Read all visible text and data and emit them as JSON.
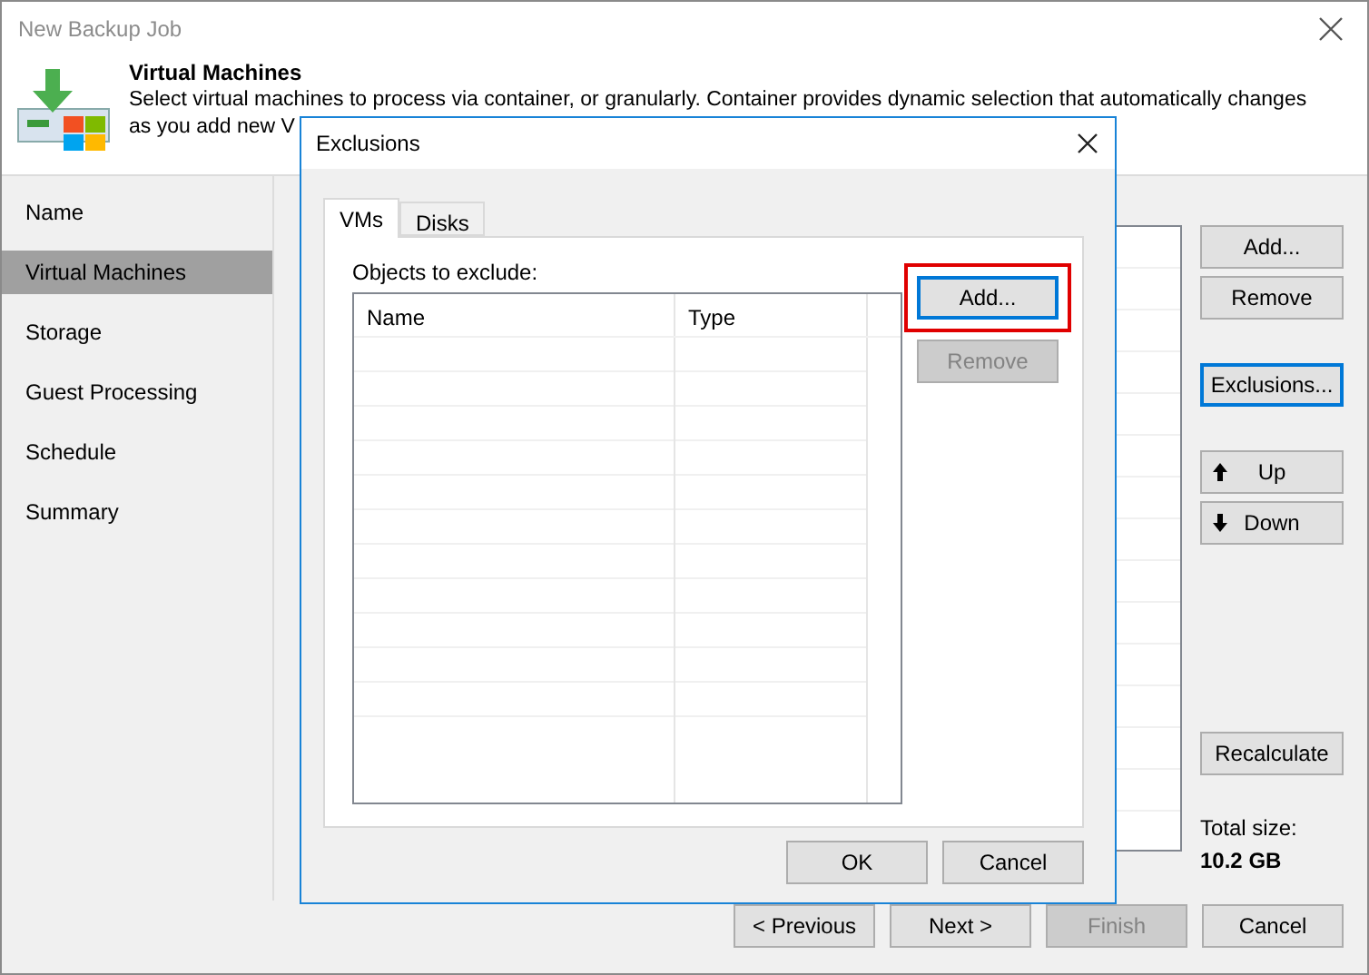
{
  "window": {
    "title": "New Backup Job"
  },
  "header": {
    "title": "Virtual Machines",
    "lines": [
      "Select virtual machines to process via container, or granularly. Container provides dynamic selection that automatically changes",
      "as you add new V"
    ]
  },
  "sidebar": {
    "items": [
      {
        "label": "Name",
        "selected": false
      },
      {
        "label": "Virtual Machines",
        "selected": true
      },
      {
        "label": "Storage",
        "selected": false
      },
      {
        "label": "Guest Processing",
        "selected": false
      },
      {
        "label": "Schedule",
        "selected": false
      },
      {
        "label": "Summary",
        "selected": false
      }
    ]
  },
  "side_button_groups": [
    [
      {
        "label": "Add...",
        "kind": "plain",
        "focused": false
      },
      {
        "label": "Remove",
        "kind": "plain",
        "focused": false
      }
    ],
    [
      {
        "label": "Exclusions...",
        "kind": "plain",
        "focused": true
      }
    ],
    [
      {
        "label": "Up",
        "kind": "up",
        "focused": false
      },
      {
        "label": "Down",
        "kind": "down",
        "focused": false
      }
    ]
  ],
  "recalculate_button": "Recalculate",
  "total_size": {
    "label": "Total size:",
    "value": "10.2 GB"
  },
  "footer_buttons": [
    {
      "label": "< Previous",
      "disabled": false
    },
    {
      "label": "Next >",
      "disabled": false
    },
    {
      "label": "Finish",
      "disabled": true
    },
    {
      "label": "Cancel",
      "disabled": false
    }
  ],
  "dialog": {
    "title": "Exclusions",
    "tabs": [
      {
        "label": "VMs",
        "selected": true
      },
      {
        "label": "Disks",
        "selected": false
      }
    ],
    "list_label": "Objects to exclude:",
    "columns": [
      "Name",
      "Type"
    ],
    "buttons": [
      {
        "label": "Add...",
        "disabled": false,
        "focused": true,
        "highlighted": true
      },
      {
        "label": "Remove",
        "disabled": true,
        "focused": false,
        "highlighted": false
      }
    ],
    "footer_buttons": [
      "OK",
      "Cancel"
    ]
  }
}
